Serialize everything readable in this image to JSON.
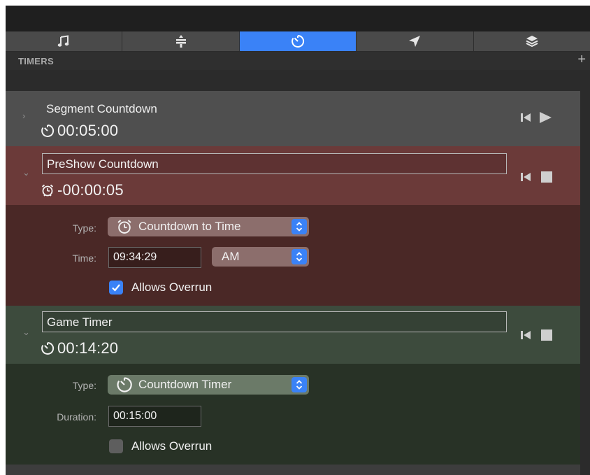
{
  "tabs": [
    {
      "icon": "music-note-icon",
      "active": false
    },
    {
      "icon": "stage-icon",
      "active": false
    },
    {
      "icon": "timer-icon",
      "active": true
    },
    {
      "icon": "send-arrow-icon",
      "active": false
    },
    {
      "icon": "layers-icon",
      "active": false
    }
  ],
  "section": {
    "title": "TIMERS",
    "add_label": "+"
  },
  "timers": [
    {
      "name": "Segment Countdown",
      "time": "00:05:00",
      "icon": "countdown-icon",
      "expanded": false,
      "running": false
    },
    {
      "name": "PreShow Countdown",
      "time": "-00:00:05",
      "icon": "alarm-clock-icon",
      "expanded": true,
      "running": true,
      "type_label": "Type:",
      "type_value": "Countdown to Time",
      "time_label": "Time:",
      "time_value": "09:34:29",
      "ampm": "AM",
      "overrun_label": "Allows Overrun",
      "overrun": true
    },
    {
      "name": "Game Timer",
      "time": "00:14:20",
      "icon": "countdown-icon",
      "expanded": true,
      "running": true,
      "type_label": "Type:",
      "type_value": "Countdown Timer",
      "duration_label": "Duration:",
      "duration_value": "00:15:00",
      "overrun_label": "Allows Overrun",
      "overrun": false
    }
  ],
  "colors": {
    "accent": "#3a82f7",
    "preshow_header": "#6b3a39",
    "preshow_detail": "#4a2826",
    "game_header": "#3d4b3d",
    "game_detail": "#283226"
  }
}
